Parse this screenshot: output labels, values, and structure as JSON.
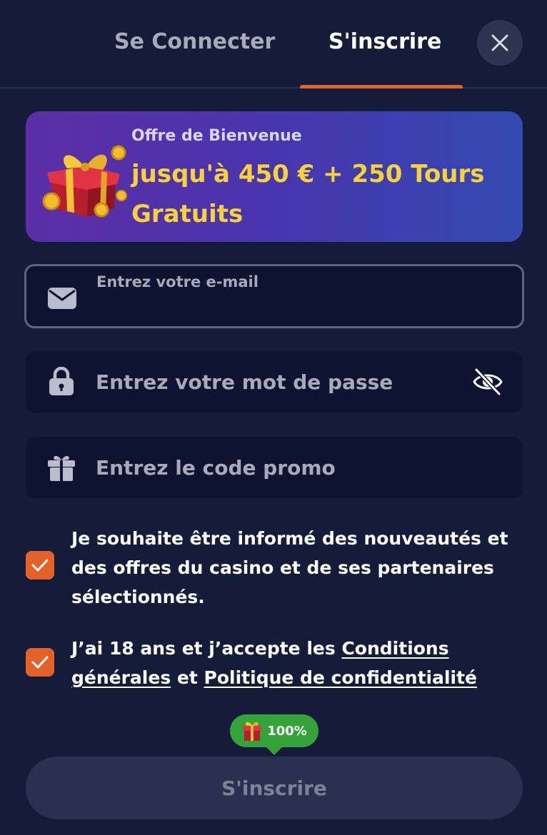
{
  "tabs": {
    "login_label": "Se Connecter",
    "register_label": "S'inscrire",
    "active": "register"
  },
  "banner": {
    "subtitle": "Offre de Bienvenue",
    "title": "jusqu'à 450 € + 250 Tours Gratuits",
    "icon": "gift-box-coins-icon"
  },
  "form": {
    "email": {
      "label": "Entrez votre e-mail",
      "value": "",
      "icon": "envelope-icon"
    },
    "password": {
      "placeholder": "Entrez votre mot de passe",
      "value": "",
      "icon": "lock-icon",
      "toggle_icon": "eye-slash-icon"
    },
    "promo": {
      "placeholder": "Entrez le code promo",
      "value": "",
      "icon": "gift-icon"
    }
  },
  "consents": {
    "newsletter": {
      "checked": true,
      "text": "Je souhaite être informé des nouveautés et des offres du casino et de ses partenaires sélectionnés."
    },
    "terms": {
      "checked": true,
      "text_before": "J’ai 18 ans et j’accepte les ",
      "terms_link": "Conditions générales",
      "text_middle": " et ",
      "privacy_link": "Politique de confidentialité"
    }
  },
  "progress_badge": {
    "value": "100%",
    "icon": "gift-icon"
  },
  "submit": {
    "label": "S'inscrire"
  },
  "colors": {
    "background": "#141c3a",
    "accent": "#e2622a",
    "promo_text": "#f7d23a",
    "badge": "#34a33a",
    "field_bg": "#0d1330"
  }
}
